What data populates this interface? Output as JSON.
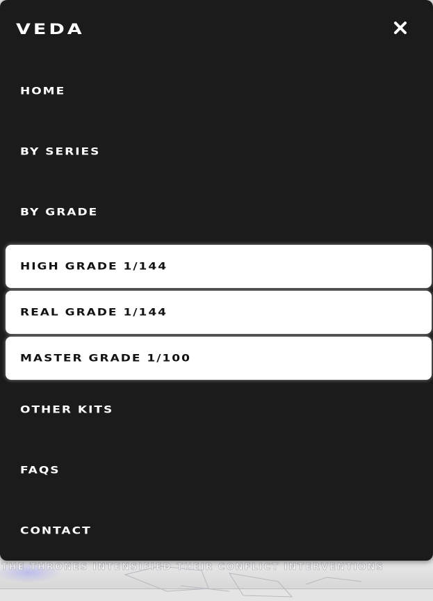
{
  "background": {
    "ticker_text": "THE THRONES INTENSIFIED THEIR CONFLICT INTERVENTIONS"
  },
  "menu": {
    "brand": "VEDA",
    "close_label": "close",
    "items": [
      {
        "label": "HOME"
      },
      {
        "label": "BY SERIES"
      },
      {
        "label": "BY GRADE"
      }
    ],
    "sub_items": [
      {
        "label": "HIGH GRADE 1/144"
      },
      {
        "label": "REAL GRADE 1/144"
      },
      {
        "label": "MASTER GRADE 1/100"
      }
    ],
    "bottom_items": [
      {
        "label": "OTHER KITS"
      },
      {
        "label": "FAQS"
      },
      {
        "label": "CONTACT"
      }
    ]
  },
  "colors": {
    "panel": "#1c1b1c",
    "text": "#ffffff",
    "sub_item_bg": "#ffffff",
    "sub_item_text": "#121212"
  }
}
